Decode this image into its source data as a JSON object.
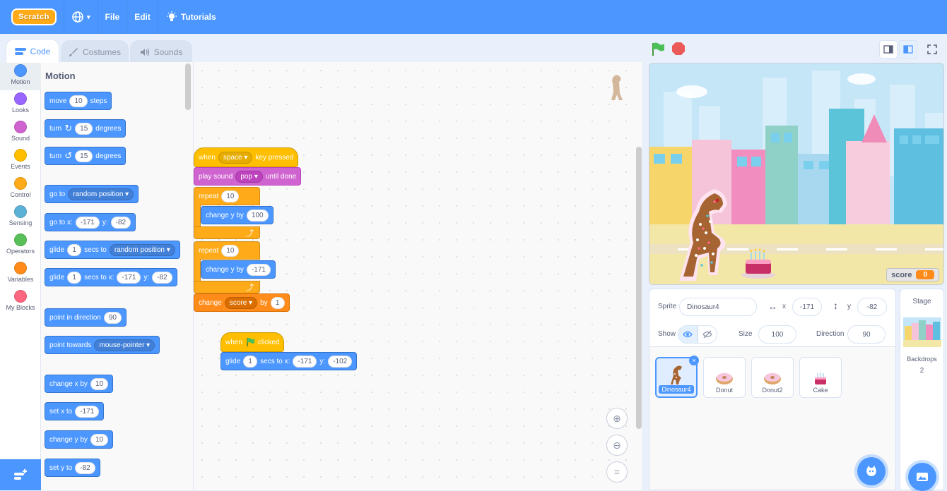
{
  "menubar": {
    "logo": "Scratch",
    "file": "File",
    "edit": "Edit",
    "tutorials": "Tutorials"
  },
  "tabs": {
    "code": "Code",
    "costumes": "Costumes",
    "sounds": "Sounds"
  },
  "categories": [
    {
      "label": "Motion",
      "color": "#4c97ff"
    },
    {
      "label": "Looks",
      "color": "#9966ff"
    },
    {
      "label": "Sound",
      "color": "#cf63cf"
    },
    {
      "label": "Events",
      "color": "#ffbf00"
    },
    {
      "label": "Control",
      "color": "#ffab19"
    },
    {
      "label": "Sensing",
      "color": "#5cb1d6"
    },
    {
      "label": "Operators",
      "color": "#59c059"
    },
    {
      "label": "Variables",
      "color": "#ff8c1a"
    },
    {
      "label": "My Blocks",
      "color": "#ff6680"
    }
  ],
  "palette": {
    "heading": "Motion",
    "move": {
      "a": "move",
      "v": "10",
      "b": "steps"
    },
    "turn_right": {
      "a": "turn",
      "v": "15",
      "b": "degrees"
    },
    "turn_left": {
      "a": "turn",
      "v": "15",
      "b": "degrees"
    },
    "goto": {
      "a": "go to",
      "d": "random position"
    },
    "gotoxy": {
      "a": "go to x:",
      "x": "-171",
      "yl": "y:",
      "y": "-82"
    },
    "glide_to": {
      "a": "glide",
      "v": "1",
      "b": "secs to",
      "d": "random position"
    },
    "glide_xy": {
      "a": "glide",
      "v": "1",
      "b": "secs to x:",
      "x": "-171",
      "yl": "y:",
      "y": "-82"
    },
    "point_dir": {
      "a": "point in direction",
      "v": "90"
    },
    "point_towards": {
      "a": "point towards",
      "d": "mouse-pointer"
    },
    "change_x": {
      "a": "change x by",
      "v": "10"
    },
    "set_x": {
      "a": "set x to",
      "v": "-171"
    },
    "change_y": {
      "a": "change y by",
      "v": "10"
    },
    "set_y": {
      "a": "set y to",
      "v": "-82"
    }
  },
  "script1": {
    "hat": {
      "a": "when",
      "d": "space",
      "b": "key pressed"
    },
    "sound": {
      "a": "play sound",
      "d": "pop",
      "b": "until done"
    },
    "repeat1": {
      "a": "repeat",
      "v": "10"
    },
    "cy1": {
      "a": "change y by",
      "v": "100"
    },
    "repeat2": {
      "a": "repeat",
      "v": "10"
    },
    "cy2": {
      "a": "change y by",
      "v": "-171"
    },
    "change": {
      "a": "change",
      "d": "score",
      "b": "by",
      "v": "1"
    }
  },
  "script2": {
    "hat": {
      "a": "when",
      "b": "clicked"
    },
    "glide": {
      "a": "glide",
      "v": "1",
      "b": "secs to x:",
      "x": "-171",
      "yl": "y:",
      "y": "-102"
    }
  },
  "stage": {
    "score_label": "score",
    "score_value": "0"
  },
  "sprite_info": {
    "sprite_label": "Sprite",
    "sprite_name": "Dinosaur4",
    "x_label": "x",
    "x_value": "-171",
    "y_label": "y",
    "y_value": "-82",
    "show_label": "Show",
    "size_label": "Size",
    "size_value": "100",
    "direction_label": "Direction",
    "direction_value": "90"
  },
  "sprites": [
    "Dinosaur4",
    "Donut",
    "Donut2",
    "Cake"
  ],
  "stage_pane": {
    "title": "Stage",
    "backdrops_label": "Backdrops",
    "backdrops_count": "2"
  }
}
